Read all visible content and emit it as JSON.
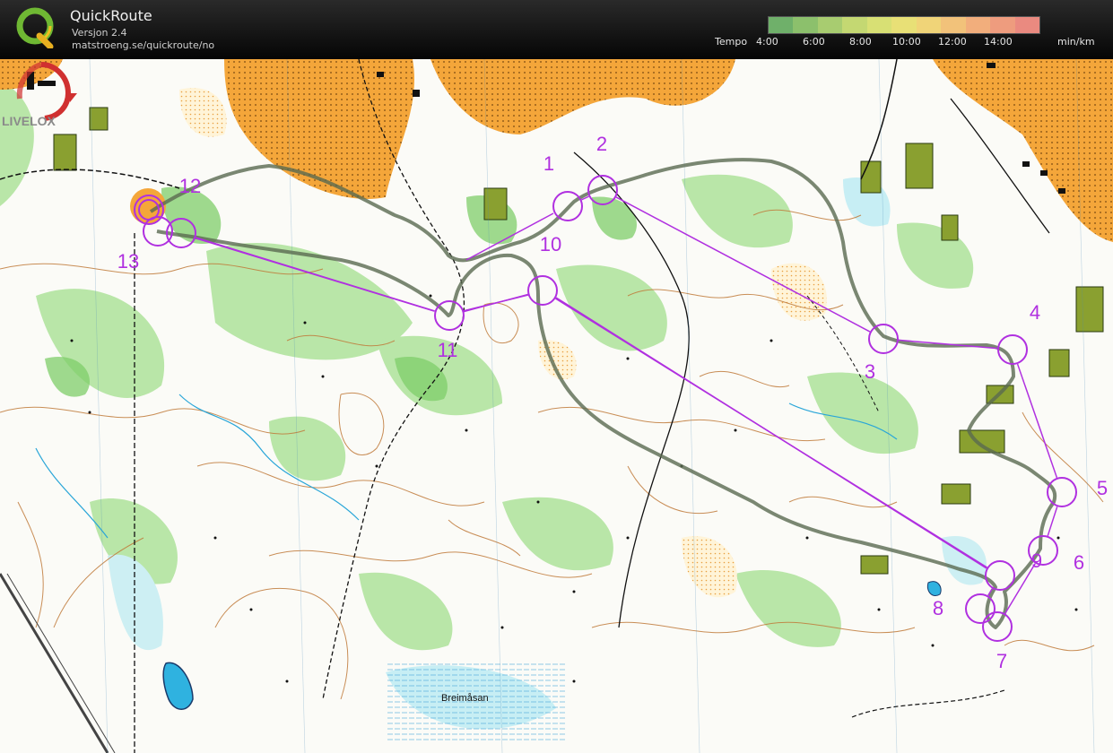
{
  "app": {
    "title": "QuickRoute",
    "version": "Versjon 2.4",
    "url": "matstroeng.se/quickroute/no"
  },
  "pace_scale": {
    "label": "Tempo",
    "ticks": [
      "4:00",
      "6:00",
      "8:00",
      "10:00",
      "12:00",
      "14:00"
    ],
    "unit": "min/km",
    "colors": [
      "#6fb06a",
      "#8cc06c",
      "#a8cc70",
      "#c4d872",
      "#d8e074",
      "#e8e076",
      "#f0d478",
      "#f2c27a",
      "#f2ae7c",
      "#ee9c7e",
      "#ea8a80"
    ]
  },
  "map": {
    "place_name": "Breimåsan",
    "live_logo_text": "LIVELOX",
    "course_color": "#b030e0",
    "route_color": "#5a6a50",
    "controls": [
      {
        "label": "1"
      },
      {
        "label": "2"
      },
      {
        "label": "3"
      },
      {
        "label": "4"
      },
      {
        "label": "5"
      },
      {
        "label": "6"
      },
      {
        "label": "7"
      },
      {
        "label": "8"
      },
      {
        "label": "9"
      },
      {
        "label": "10"
      },
      {
        "label": "11"
      },
      {
        "label": "12"
      },
      {
        "label": "13"
      }
    ]
  }
}
